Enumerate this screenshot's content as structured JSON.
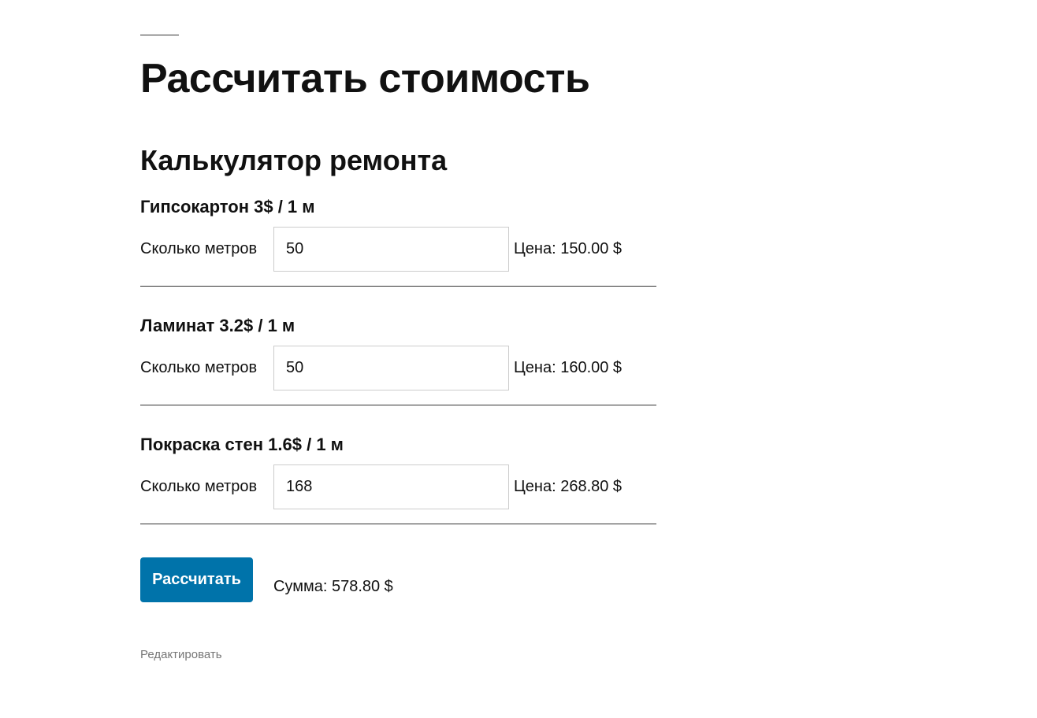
{
  "page": {
    "title": "Рассчитать стоимость"
  },
  "calculator": {
    "title": "Калькулятор ремонта",
    "items": [
      {
        "heading": "Гипсокартон 3$ / 1 м",
        "qty_label": "Сколько метров",
        "qty_value": "50",
        "price": "Цена: 150.00 $"
      },
      {
        "heading": "Ламинат 3.2$ / 1 м",
        "qty_label": "Сколько метров",
        "qty_value": "50",
        "price": "Цена: 160.00 $"
      },
      {
        "heading": "Покраска стен 1.6$ / 1 м",
        "qty_label": "Сколько метров",
        "qty_value": "168",
        "price": "Цена: 268.80 $"
      }
    ],
    "button_label": "Рассчитать",
    "total": "Сумма: 578.80 $"
  },
  "footer": {
    "edit_label": "Редактировать"
  },
  "colors": {
    "accent": "#0073aa",
    "text": "#111111",
    "muted": "#767676",
    "input_border": "#cccccc"
  }
}
